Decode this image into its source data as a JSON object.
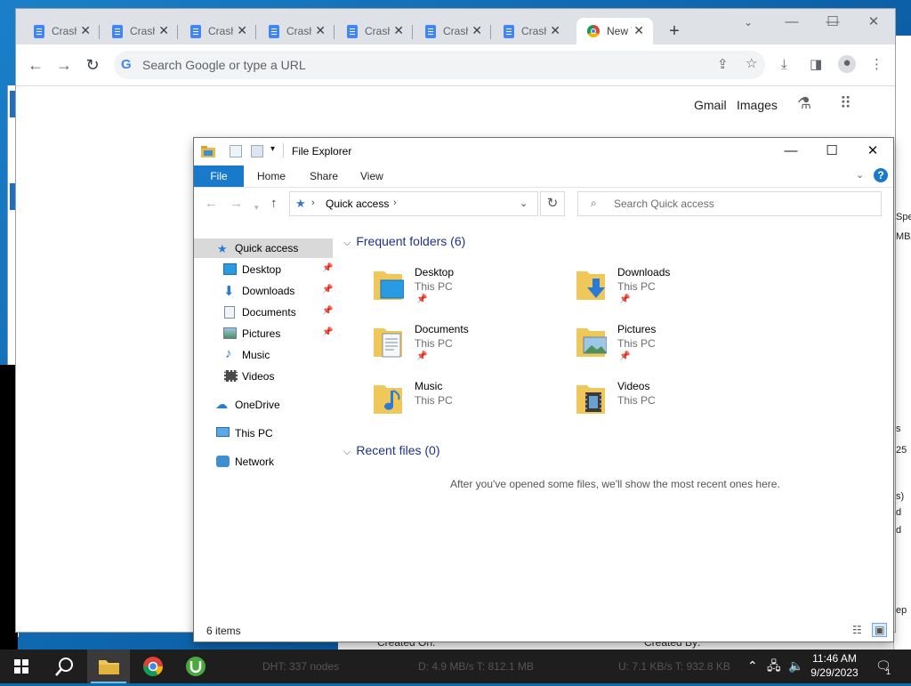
{
  "chrome": {
    "tabs": [
      {
        "label": "Crash"
      },
      {
        "label": "Crash"
      },
      {
        "label": "Crash"
      },
      {
        "label": "Crash"
      },
      {
        "label": "Crash"
      },
      {
        "label": "Crash"
      },
      {
        "label": "Crash"
      },
      {
        "label": "New Tab",
        "active": true
      }
    ],
    "new_tab_symbol": "+",
    "omnibox_placeholder": "Search Google or type a URL",
    "gmail": "Gmail",
    "images": "Images"
  },
  "explorer": {
    "title": "File Explorer",
    "ribbon_tabs": {
      "file": "File",
      "home": "Home",
      "share": "Share",
      "view": "View"
    },
    "help": "?",
    "address": "Quick access",
    "search_placeholder": "Search Quick access",
    "sidebar": {
      "quick_access": "Quick access",
      "desktop": "Desktop",
      "downloads": "Downloads",
      "documents": "Documents",
      "pictures": "Pictures",
      "music": "Music",
      "videos": "Videos",
      "onedrive": "OneDrive",
      "this_pc": "This PC",
      "network": "Network"
    },
    "frequent_header": "Frequent folders (6)",
    "folders": {
      "desktop": {
        "name": "Desktop",
        "location": "This PC"
      },
      "downloads": {
        "name": "Downloads",
        "location": "This PC"
      },
      "documents": {
        "name": "Documents",
        "location": "This PC"
      },
      "pictures": {
        "name": "Pictures",
        "location": "This PC"
      },
      "music": {
        "name": "Music",
        "location": "This PC"
      },
      "videos": {
        "name": "Videos",
        "location": "This PC"
      }
    },
    "recent_header": "Recent files (0)",
    "recent_empty": "After you've opened some files, we'll show the most recent ones here.",
    "status": "6 items"
  },
  "background": {
    "dht": "DHT: 337 nodes",
    "download": "D: 4.9 MB/s T: 812.1 MB",
    "upload": "U: 7.1 KB/s T: 932.8 KB",
    "created_on": "Created On:",
    "created_by": "Created By:",
    "right_fragments": [
      "Spee",
      "MB/",
      "s",
      "25",
      "s)",
      "d",
      "d",
      "ep"
    ]
  },
  "taskbar": {
    "time": "11:46 AM",
    "date": "9/29/2023",
    "notification_count": "1"
  },
  "colors": {
    "accent": "#1979ca",
    "header_text": "#1e3287",
    "taskbar": "#1e1e1e",
    "chrome_tabstrip": "#dee1e6"
  }
}
